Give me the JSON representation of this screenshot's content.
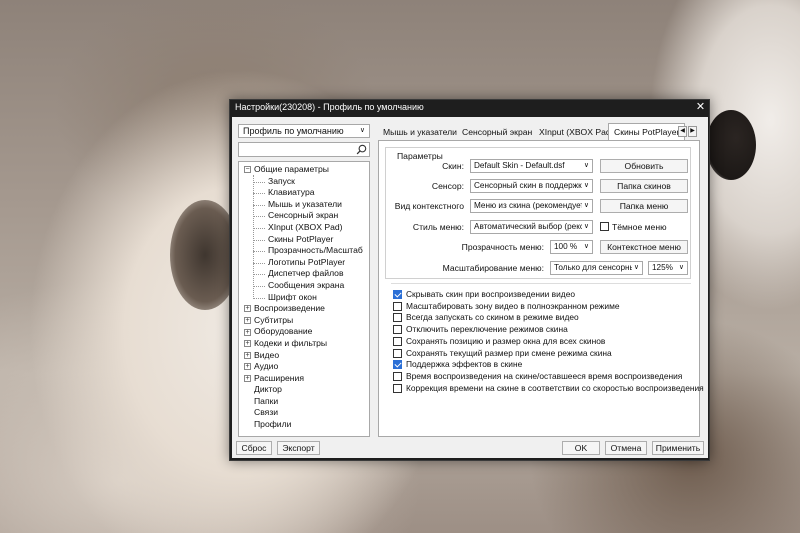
{
  "window": {
    "title": "Настройки(230208) - Профиль по умолчанию",
    "close_glyph": "✕"
  },
  "left": {
    "profile_select": "Профиль по умолчанию",
    "search_placeholder": "",
    "tree": [
      {
        "label": "Общие параметры",
        "level": 0,
        "expander": "−"
      },
      {
        "label": "Запуск",
        "level": 1
      },
      {
        "label": "Клавиатура",
        "level": 1
      },
      {
        "label": "Мышь и указатели",
        "level": 1
      },
      {
        "label": "Сенсорный экран",
        "level": 1
      },
      {
        "label": "XInput (XBOX Pad)",
        "level": 1
      },
      {
        "label": "Скины PotPlayer",
        "level": 1
      },
      {
        "label": "Прозрачность/Масштаб",
        "level": 1
      },
      {
        "label": "Логотипы PotPlayer",
        "level": 1
      },
      {
        "label": "Диспетчер файлов",
        "level": 1
      },
      {
        "label": "Сообщения экрана",
        "level": 1
      },
      {
        "label": "Шрифт окон",
        "level": 1
      },
      {
        "label": "Воспроизведение",
        "level": 0,
        "expander": "+"
      },
      {
        "label": "Субтитры",
        "level": 0,
        "expander": "+"
      },
      {
        "label": "Оборудование",
        "level": 0,
        "expander": "+"
      },
      {
        "label": "Кодеки и фильтры",
        "level": 0,
        "expander": "+"
      },
      {
        "label": "Видео",
        "level": 0,
        "expander": "+"
      },
      {
        "label": "Аудио",
        "level": 0,
        "expander": "+"
      },
      {
        "label": "Расширения",
        "level": 0,
        "expander": "+"
      },
      {
        "label": "Диктор",
        "level": 0
      },
      {
        "label": "Папки",
        "level": 0
      },
      {
        "label": "Связи",
        "level": 0
      },
      {
        "label": "Профили",
        "level": 0
      }
    ]
  },
  "tabs": [
    "Мышь и указатели",
    "Сенсорный экран",
    "XInput (XBOX Pad)",
    "Скины PotPlayer"
  ],
  "active_tab": "Скины PotPlayer",
  "tab_arrows": [
    "◀",
    "▶"
  ],
  "params": {
    "group_title": "Параметры",
    "skin_label": "Скин:",
    "skin_value": "Default Skin - Default.dsf",
    "refresh_button": "Обновить",
    "sensor_label": "Сенсор:",
    "sensor_value": "Сенсорный скин в поддержке",
    "skins_folder_button": "Папка скинов",
    "context_label": "Вид контекстного",
    "context_value": "Меню из скина (рекомендует",
    "menu_folder_button": "Папка меню",
    "menu_style_label": "Стиль меню:",
    "menu_style_value": "Автоматический выбор (рекс",
    "dark_menu_label": "Тёмное меню",
    "dark_menu_checked": false,
    "menu_opacity_label": "Прозрачность меню:",
    "menu_opacity_value": "100 %",
    "context_menu_button": "Контекстное меню",
    "menu_scale_label": "Масштабирование меню:",
    "menu_scale_mode": "Только для сенсорны",
    "menu_scale_value": "125%"
  },
  "options": [
    {
      "label": "Скрывать скин при воспроизведении видео",
      "checked": true
    },
    {
      "label": "Масштабировать зону видео в полноэкранном режиме",
      "checked": false
    },
    {
      "label": "Всегда запускать со скином в режиме видео",
      "checked": false
    },
    {
      "label": "Отключить переключение режимов скина",
      "checked": false
    },
    {
      "label": "Сохранять позицию и размер окна для всех скинов",
      "checked": false
    },
    {
      "label": "Сохранять текущий размер при смене режима скина",
      "checked": false
    },
    {
      "label": "Поддержка эффектов в скине",
      "checked": true
    },
    {
      "label": "Время воспроизведения на скине/оставшееся время воспроизведения",
      "checked": false
    },
    {
      "label": "Коррекция времени на скине в соответствии со скоростью воспроизведения",
      "checked": false
    }
  ],
  "buttons": {
    "reset": "Сброс",
    "export": "Экспорт",
    "ok": "OK",
    "cancel": "Отмена",
    "apply": "Применить"
  },
  "dropdown_arrow": "∨"
}
